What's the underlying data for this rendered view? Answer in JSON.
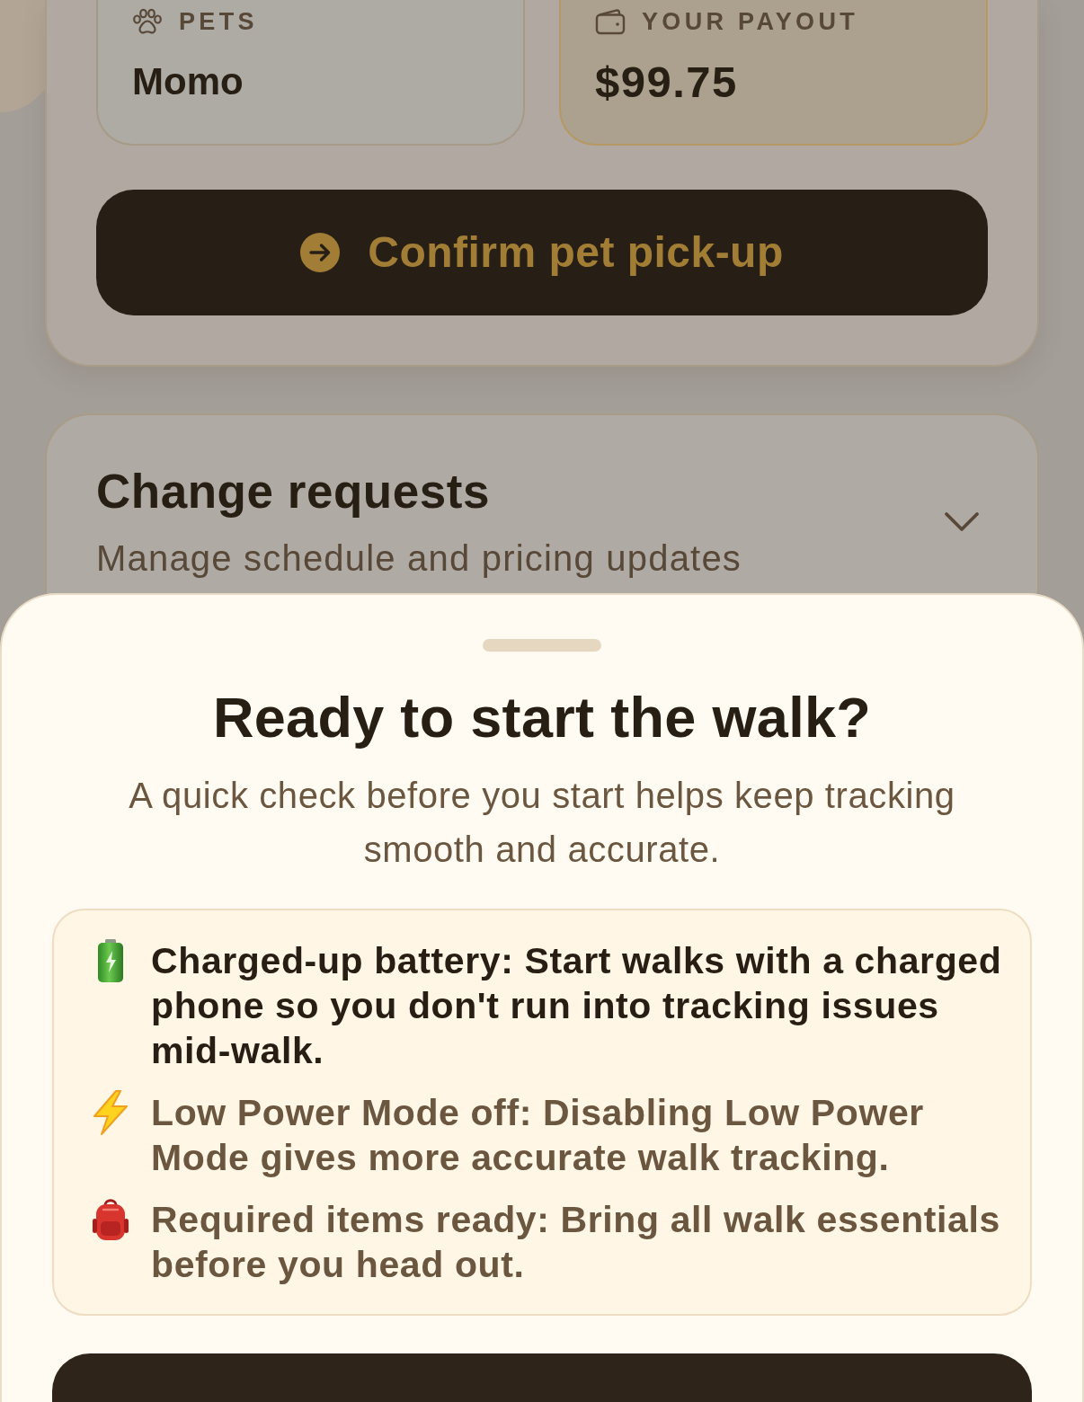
{
  "pickup_card": {
    "fields": [
      {
        "kind": "pets",
        "label": "PETS",
        "value": "Momo",
        "highlighted": false
      },
      {
        "kind": "payout",
        "label": "YOUR PAYOUT",
        "value": "$99.75",
        "highlighted": true
      }
    ],
    "confirm_button": {
      "label": "Confirm pet pick-up"
    }
  },
  "change_requests": {
    "title": "Change requests",
    "subtitle": "Manage schedule and pricing updates",
    "expanded": false
  },
  "sheet": {
    "title": "Ready to start the walk?",
    "subtitle": "A quick check before you start helps keep tracking smooth and accurate.",
    "checklist": [
      {
        "kind": "battery",
        "text": "Charged-up battery: Start walks with a charged phone so you don't run into tracking issues mid-walk.",
        "highlighted": true
      },
      {
        "kind": "power",
        "text": "Low Power Mode off: Disabling Low Power Mode gives more accurate walk tracking.",
        "highlighted": false
      },
      {
        "kind": "items",
        "text": "Required items ready: Bring all walk essentials before you head out.",
        "highlighted": false
      }
    ]
  }
}
